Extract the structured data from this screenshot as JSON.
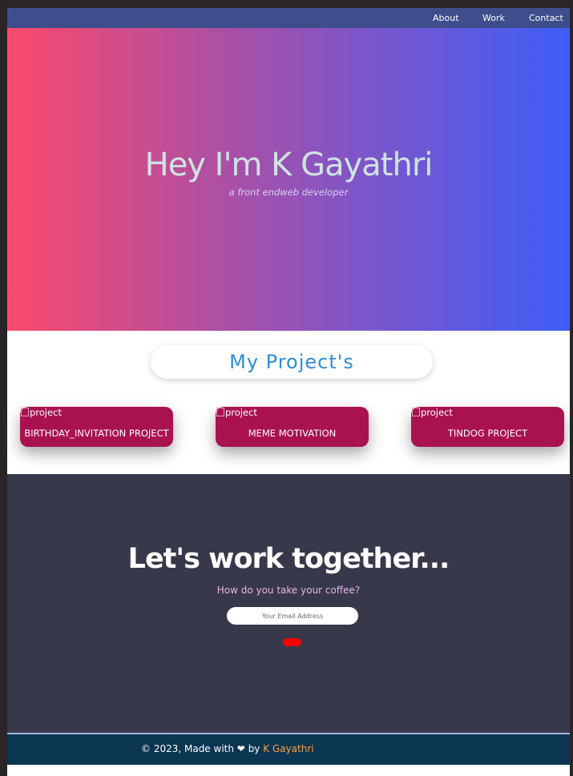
{
  "nav": {
    "items": [
      {
        "label": "About"
      },
      {
        "label": "Work"
      },
      {
        "label": "Contact"
      }
    ]
  },
  "hero": {
    "title": "Hey I'm K Gayathri",
    "subtitle": "a front endweb developer"
  },
  "projects": {
    "title": "My Project's",
    "cards": [
      {
        "image_alt": "project",
        "label": "BIRTHDAY_INVITATION PROJECT"
      },
      {
        "image_alt": "project",
        "label": "MEME MOTIVATION"
      },
      {
        "image_alt": "project",
        "label": "TINDOG PROJECT"
      }
    ]
  },
  "contact": {
    "title": "Let's work together...",
    "tagline": "How do you take your coffee?",
    "email_placeholder": "Your Email Address",
    "button_label": ""
  },
  "footer": {
    "prefix": "© 2023, Made with",
    "heart_icon": "heart-icon",
    "by": "by",
    "author": "K Gayathri"
  },
  "colors": {
    "nav": "#3e4e8c",
    "hero_gradient_start": "#fc4a6b",
    "hero_gradient_end": "#3f5ef7",
    "project_card": "#a9124f",
    "project_title": "#2d8ed8",
    "contact_bg": "#37384a",
    "subscribe_button": "#ff0000",
    "footer_bg": "#0b3651",
    "author_accent": "#f7a14b"
  }
}
